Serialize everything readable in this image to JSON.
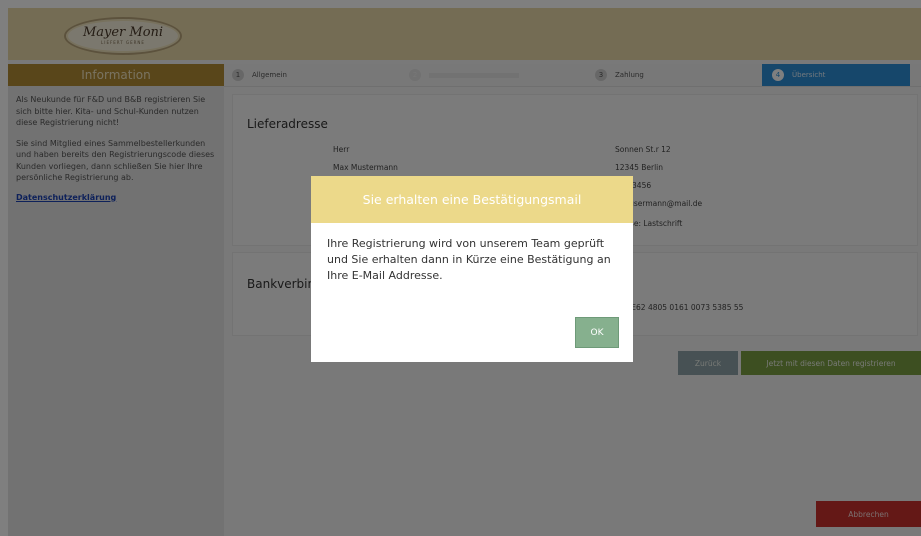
{
  "header": {
    "logo_text": "Mayer Moni",
    "logo_subtext": "LIEFERT GERNE"
  },
  "sidebar": {
    "title": "Information",
    "paragraph1": "Als Neukunde für F&D und B&B registrieren Sie sich bitte hier. Kita- und Schul-Kunden nutzen diese Registrierung nicht!",
    "paragraph2": "Sie sind Mitglied eines Sammelbestellerkunden und haben bereits den Registrierungscode dieses Kunden vorliegen, dann schließen Sie hier Ihre persönliche Registrierung ab.",
    "privacy_link": "Datenschutzerklärung"
  },
  "steps": [
    {
      "num": "1",
      "label": "Allgemein",
      "state": "done"
    },
    {
      "num": "2",
      "label": "",
      "state": "faded"
    },
    {
      "num": "3",
      "label": "Zahlung",
      "state": "done"
    },
    {
      "num": "4",
      "label": "Übersicht",
      "state": "active"
    }
  ],
  "delivery": {
    "title": "Lieferadresse",
    "salutation": "Herr",
    "name": "Max Mustermann",
    "street": "Sonnen St.r 12",
    "city": "12345 Berlin",
    "phone": "3-123456",
    "email": "x.musermann@mail.de",
    "payment": "lweise: Lastschrift"
  },
  "bank": {
    "title": "Bankverbind",
    "iban": "N: DE62 4805 0161 0073 5385 55"
  },
  "buttons": {
    "back": "Zurück",
    "register": "Jetzt mit diesen Daten registrieren",
    "cancel": "Abbrechen"
  },
  "modal": {
    "title": "Sie erhalten eine Bestätigungsmail",
    "body": "Ihre Registrierung wird von unserem Team geprüft und Sie erhalten dann in Kürze eine Bestätigung an Ihre E-Mail Addresse.",
    "ok": "OK"
  },
  "colors": {
    "topbar": "#e8d9a8",
    "sidebar_header": "#b38d34",
    "step_active": "#2c8fd6",
    "register_button": "#7a9e42",
    "cancel_button": "#c9302c",
    "modal_header": "#ecd98a",
    "ok_button": "#86b08e"
  }
}
